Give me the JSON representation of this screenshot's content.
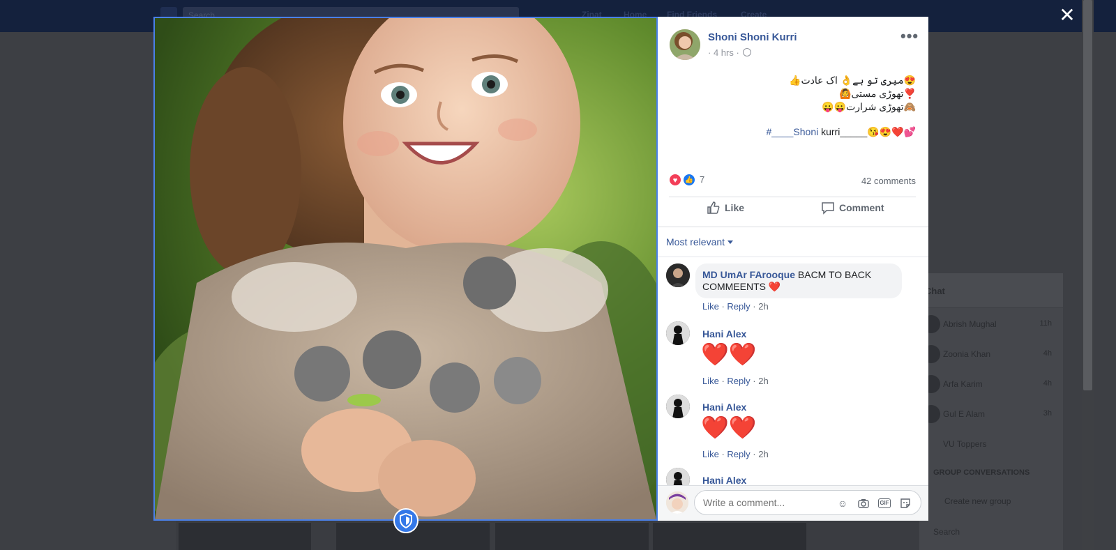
{
  "background": {
    "search_placeholder": "Search",
    "nav": [
      "Zinat",
      "Home",
      "Find Friends",
      "Create"
    ],
    "chat": {
      "title": "Chat",
      "contacts": [
        {
          "name": "Abrish Mughal",
          "time": "11h"
        },
        {
          "name": "Zoonia Khan",
          "time": "4h"
        },
        {
          "name": "Arfa Karim",
          "time": "4h"
        },
        {
          "name": "Gul E Alam",
          "time": "3h"
        },
        {
          "name": "VU Toppers",
          "time": ""
        }
      ],
      "section": "GROUP CONVERSATIONS",
      "create_group": "Create new group",
      "search": "Search"
    }
  },
  "viewer": {
    "close_label": "✕"
  },
  "post": {
    "author": "Shoni Shoni Kurri",
    "time": "4 hrs",
    "more_label": "•••",
    "text_lines": [
      "😍میری تو ہے👌 اک عادت👍",
      "❣️تھوڑی مستی🙆",
      "🙈تھوڑی شرارت😛😛"
    ],
    "tag_prefix": "#____",
    "tag_blue": "Shoni",
    "tag_rest": " kurri_____😘😍❤️💕",
    "reaction_count": "7",
    "comments_count": "42 comments",
    "like_label": "Like",
    "comment_label": "Comment",
    "sort_label": "Most relevant"
  },
  "comments": [
    {
      "name": "MD UmAr FArooque",
      "text": " BACM TO BACK COMMEENTS ❤️",
      "like": "Like",
      "reply": "Reply",
      "time": "2h"
    },
    {
      "name": "Hani Alex",
      "text": "❤️❤️",
      "like": "Like",
      "reply": "Reply",
      "time": "2h"
    },
    {
      "name": "Hani Alex",
      "text": "❤️❤️",
      "like": "Like",
      "reply": "Reply",
      "time": "2h"
    },
    {
      "name": "Hani Alex",
      "text": "",
      "like": "",
      "reply": "",
      "time": ""
    }
  ],
  "composer": {
    "placeholder": "Write a comment...",
    "icons": [
      "emoji-icon",
      "camera-icon",
      "gif-icon",
      "sticker-icon"
    ],
    "gif_label": "GIF"
  },
  "colors": {
    "link": "#385898",
    "accent": "#4a80e8",
    "love": "#f33e58",
    "like": "#1877f2"
  }
}
